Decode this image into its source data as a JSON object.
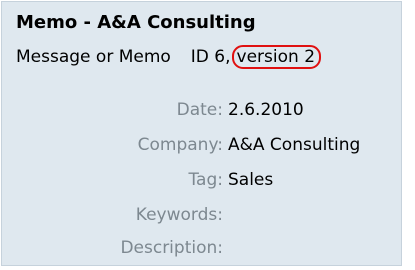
{
  "memo": {
    "title": "Memo - A&A Consulting",
    "type_label": "Message or Memo",
    "id_text": "ID 6,",
    "version_text": "version 2"
  },
  "fields": [
    {
      "label": "Date:",
      "value": "2.6.2010"
    },
    {
      "label": "Company:",
      "value": "A&A Consulting"
    },
    {
      "label": "Tag:",
      "value": "Sales"
    },
    {
      "label": "Keywords:",
      "value": ""
    },
    {
      "label": "Description:",
      "value": ""
    }
  ],
  "colors": {
    "panel_background": "#dfe8ef",
    "label_text": "#7d8890",
    "version_highlight": "#e01010"
  }
}
